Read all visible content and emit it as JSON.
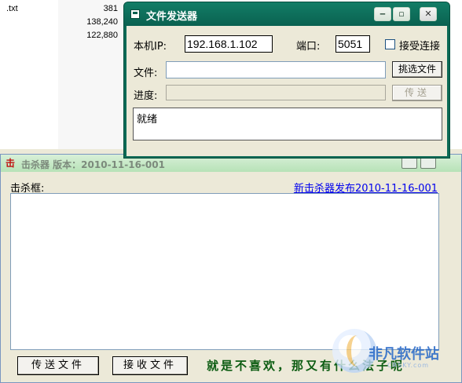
{
  "background_list": {
    "rows": [
      {
        "name": ".txt",
        "size": "381"
      },
      {
        "name": "",
        "size": "138,240"
      },
      {
        "name": "",
        "size": "122,880"
      }
    ]
  },
  "killer_window": {
    "title": "击杀器 版本：2010-11-16-001",
    "kill_box_label": "击杀框:",
    "link_new_release": "新击杀器发布2010-11-16-001",
    "kill_box_content": "",
    "send_button": "传送文件",
    "receive_button": "接收文件",
    "slogan": "就是不喜欢，那又有什么法子呢",
    "watermark": {
      "text": "非凡软件站",
      "sub": "CRSKY.com"
    }
  },
  "sender_window": {
    "title": "文件发送器",
    "local_ip_label": "本机IP:",
    "local_ip_value": "192.168.1.102",
    "port_label": "端口:",
    "port_value": "5051",
    "accept_label": "接受连接",
    "accept_checked": false,
    "file_label": "文件:",
    "file_value": "",
    "choose_file_button": "挑选文件",
    "progress_label": "进度:",
    "progress_value": 0,
    "send_button": "传送",
    "status_text": "就绪",
    "colors": {
      "titlebar": "#0b6a55",
      "body": "#ece9d8"
    }
  }
}
